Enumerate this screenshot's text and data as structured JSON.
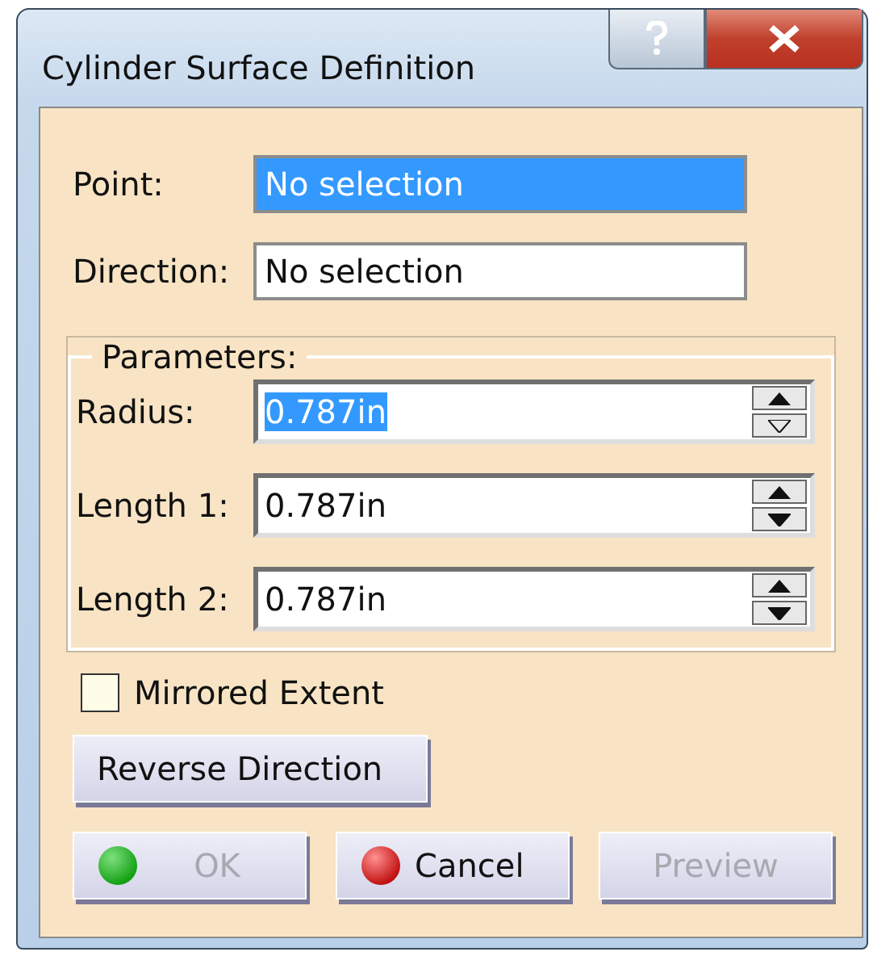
{
  "window": {
    "title": "Cylinder Surface Definition"
  },
  "fields": [
    {
      "label": "Point:",
      "value": "No selection",
      "selected": true
    },
    {
      "label": "Direction:",
      "value": "No selection",
      "selected": false
    }
  ],
  "parameters": {
    "title": "Parameters:",
    "spinners": [
      {
        "label": "Radius:",
        "value": "0.787in",
        "selected": true
      },
      {
        "label": "Length 1:",
        "value": "0.787in",
        "selected": false
      },
      {
        "label": "Length 2:",
        "value": "0.787in",
        "selected": false
      }
    ]
  },
  "mirrored_extent": {
    "label": "Mirrored Extent",
    "checked": false
  },
  "reverse_button": {
    "label": "Reverse Direction"
  },
  "buttons": [
    {
      "label": "OK",
      "kind": "ok",
      "disabled": true
    },
    {
      "label": "Cancel",
      "kind": "cancel",
      "disabled": false
    },
    {
      "label": "Preview",
      "kind": "plain",
      "disabled": true
    }
  ]
}
